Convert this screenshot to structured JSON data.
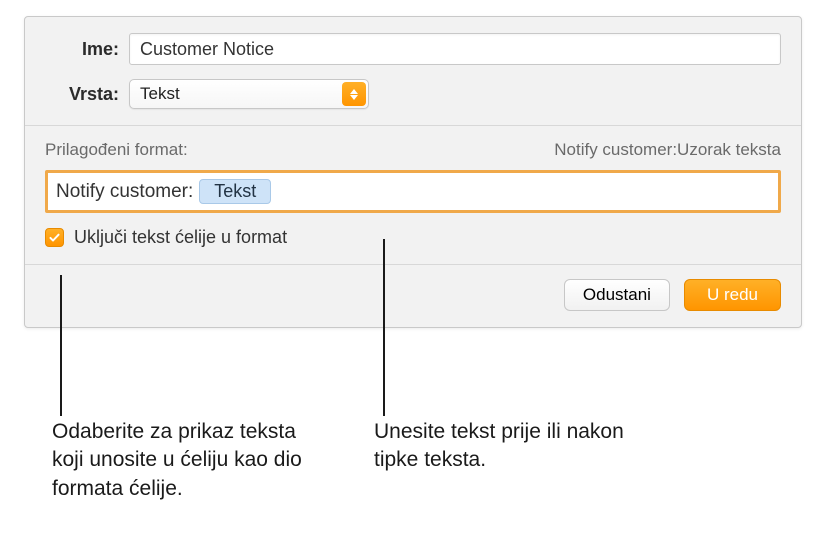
{
  "form": {
    "name_label": "Ime:",
    "name_value": "Customer Notice",
    "type_label": "Vrsta:",
    "type_value": "Tekst"
  },
  "custom_format": {
    "section_label": "Prilagođeni format:",
    "preview": "Notify customer:Uzorak teksta",
    "prefix_text": "Notify customer:",
    "token_label": "Tekst"
  },
  "checkbox": {
    "checked": true,
    "label": "Uključi tekst ćelije u format"
  },
  "buttons": {
    "cancel": "Odustani",
    "ok": "U redu"
  },
  "callouts": {
    "left": "Odaberite za prikaz teksta koji unosite u ćeliju kao dio formata ćelije.",
    "right": "Unesite tekst prije ili nakon tipke teksta."
  }
}
